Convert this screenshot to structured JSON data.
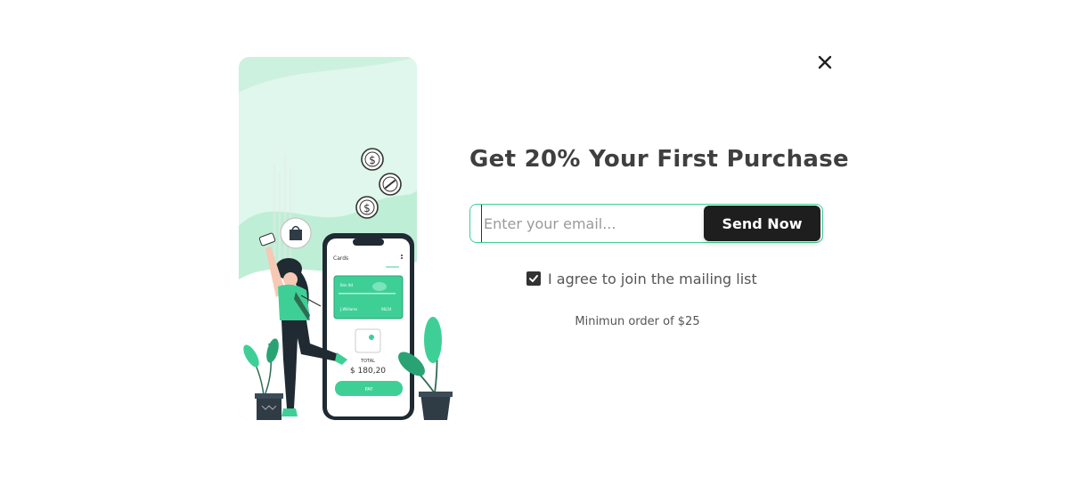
{
  "popup": {
    "headline": "Get 20% Your First Purchase",
    "email_placeholder": "Enter your email...",
    "email_value": "",
    "send_label": "Send Now",
    "agree_label": "I agree to join the mailing list",
    "agree_checked": true,
    "min_order_text": "Minimun order of $25"
  },
  "phone": {
    "app_title": "Cards",
    "card_bank": "Bnk ltd",
    "card_holder": "J.Williams",
    "card_expiry": "06/24",
    "total_label": "TOTAL",
    "total_amount": "$ 180,20",
    "pay_label": "PAY"
  },
  "icons": {
    "close": "close-icon",
    "check": "check-icon",
    "dollar": "dollar-coin-icon",
    "link": "link-coin-icon",
    "bag": "shopping-bag-icon"
  },
  "colors": {
    "accent": "#3ecf97",
    "dark": "#1e1e1e",
    "mint": "#c9f0de"
  }
}
